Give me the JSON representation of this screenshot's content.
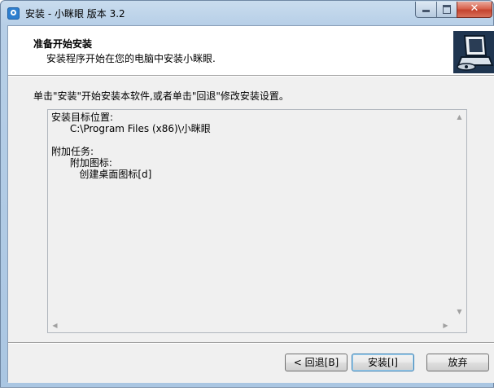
{
  "window": {
    "title": "安装 - 小眯眼 版本 3.2",
    "controls": [
      "minimize-icon",
      "maximize-icon",
      "close-icon"
    ],
    "close_glyph": "✕"
  },
  "header": {
    "title": "准备开始安装",
    "subtitle": "安装程序开始在您的电脑中安装小眯眼."
  },
  "body": {
    "instruction": "单击\"安装\"开始安装本软件,或者单击\"回退\"修改安装设置。",
    "memo_lines": [
      "安装目标位置:",
      "      C:\\Program Files (x86)\\小眯眼",
      "",
      "附加任务:",
      "      附加图标:",
      "         创建桌面图标[d]"
    ]
  },
  "buttons": {
    "back": "< 回退[B]",
    "install": "安装[I]",
    "cancel": "放弃"
  },
  "scroll": {
    "up": "▲",
    "down": "▼",
    "left": "◀",
    "right": "▶"
  },
  "colors": {
    "frame": "#b7cfe7",
    "close_button": "#c4432e",
    "default_button_border": "#3c7fb1",
    "panel": "#f0f0f0"
  }
}
